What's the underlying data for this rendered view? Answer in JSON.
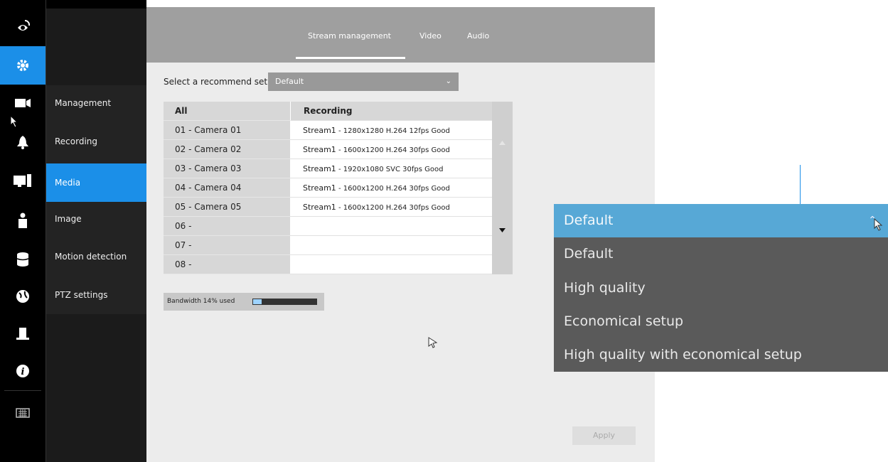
{
  "header": {
    "tabs": [
      {
        "label": "Stream management"
      },
      {
        "label": "Video"
      },
      {
        "label": "Audio"
      }
    ],
    "active_tab": "Stream management"
  },
  "rail": {
    "icons": [
      "back-eye-icon",
      "gear-icon",
      "camera-icon",
      "bell-icon",
      "monitor-icon",
      "person-icon",
      "database-icon",
      "globe-icon",
      "plugin-icon",
      "info-icon",
      "keyboard-icon"
    ],
    "active": "gear-icon"
  },
  "submenu": {
    "items": [
      {
        "label": "Management"
      },
      {
        "label": "Recording"
      },
      {
        "label": "Media"
      },
      {
        "label": "Image"
      },
      {
        "label": "Motion detection"
      },
      {
        "label": "PTZ settings"
      }
    ],
    "active": "Media"
  },
  "recommend": {
    "label": "Select a recommend set:",
    "value": "Default"
  },
  "table": {
    "headers": {
      "camera": "All",
      "stream": "Recording"
    },
    "rows": [
      {
        "camera": "01 - Camera 01",
        "stream": "Stream1",
        "detail": " - 1280x1280 H.264 12fps Good"
      },
      {
        "camera": "02 - Camera 02",
        "stream": "Stream1",
        "detail": " - 1600x1200 H.264 30fps Good"
      },
      {
        "camera": "03 - Camera 03",
        "stream": "Stream1",
        "detail": " - 1920x1080 SVC 30fps Good"
      },
      {
        "camera": "04 - Camera 04",
        "stream": "Stream1",
        "detail": " - 1600x1200 H.264 30fps Good"
      },
      {
        "camera": "05 - Camera 05",
        "stream": "Stream1",
        "detail": " - 1600x1200 H.264 30fps Good"
      },
      {
        "camera": "06 -",
        "stream": "",
        "detail": ""
      },
      {
        "camera": "07 -",
        "stream": "",
        "detail": ""
      },
      {
        "camera": "08 -",
        "stream": "",
        "detail": ""
      }
    ]
  },
  "bandwidth": {
    "label": "Bandwidth 14% used",
    "percent": 14
  },
  "apply_label": "Apply",
  "zoom_dropdown": {
    "selected": "Default",
    "options": [
      "Default",
      "High quality",
      "Economical setup",
      "High quality with economical setup"
    ]
  },
  "colors": {
    "accent": "#1b8fe8",
    "header": "#9f9f9f",
    "dropdown_selected": "#57a8d6"
  }
}
